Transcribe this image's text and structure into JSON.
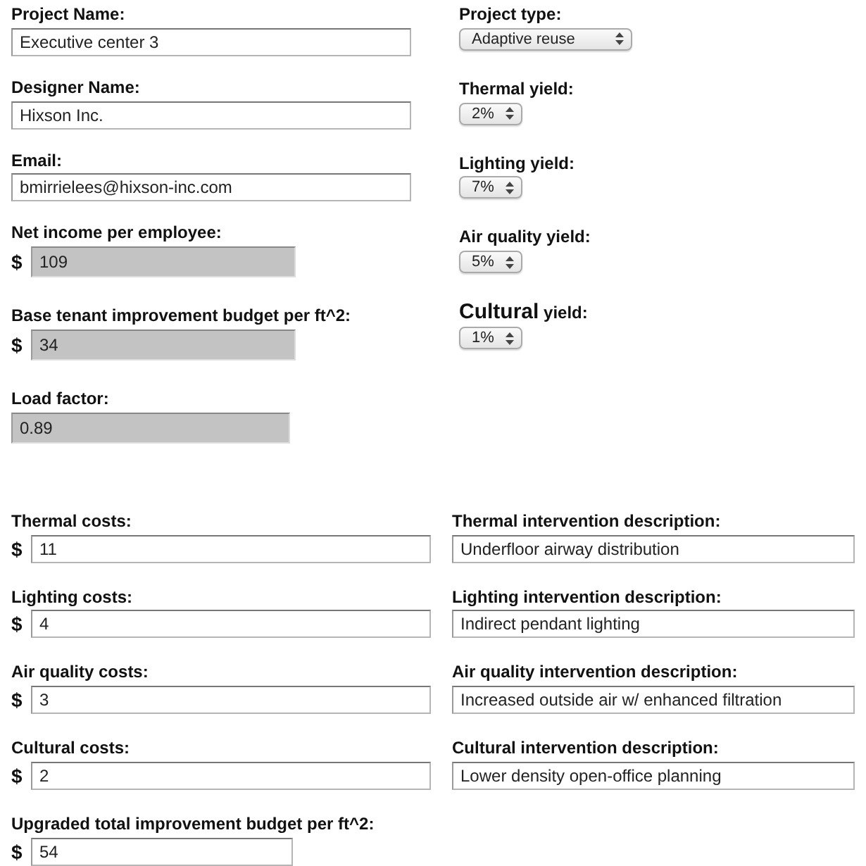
{
  "top_left": [
    {
      "label": "Project Name:",
      "value": "Executive center 3",
      "readonly": false
    },
    {
      "label": "Designer Name:",
      "value": "Hixson Inc.",
      "readonly": false
    },
    {
      "label": "Email:",
      "value": "bmirrielees@hixson-inc.com",
      "readonly": false
    },
    {
      "label": "Net income per employee:",
      "prefix": "$",
      "value": "109",
      "readonly": true
    },
    {
      "label": "Base tenant improvement budget per ft^2:",
      "prefix": "$",
      "value": "34",
      "readonly": true
    },
    {
      "label": "Load factor:",
      "value": "0.89",
      "readonly": true
    }
  ],
  "top_right": [
    {
      "kind": "wide",
      "label": "Project type:",
      "value": "Adaptive reuse"
    },
    {
      "kind": "narrow",
      "label": "Thermal yield:",
      "value": "2%"
    },
    {
      "kind": "narrow",
      "label": "Lighting yield:",
      "value": "7%"
    },
    {
      "kind": "narrow",
      "label": "Air quality yield:",
      "value": "5%"
    },
    {
      "kind": "narrow",
      "label_emphasis": "Cultural",
      "label": "yield:",
      "value": "1%"
    }
  ],
  "interventions": [
    {
      "cost_label": "Thermal costs:",
      "cost_prefix": "$",
      "cost": "11",
      "description_label": "Thermal intervention description:",
      "description": "Underfloor airway distribution"
    },
    {
      "cost_label": "Lighting costs:",
      "cost_prefix": "$",
      "cost": "4",
      "description_label": "Lighting intervention description:",
      "description": "Indirect pendant lighting"
    },
    {
      "cost_label": "Air quality costs:",
      "cost_prefix": "$",
      "cost": "3",
      "description_label": "Air quality intervention description:",
      "description": "Increased outside air w/ enhanced filtration"
    },
    {
      "cost_label": "Cultural costs:",
      "cost_prefix": "$",
      "cost": "2",
      "description_label": "Cultural intervention description:",
      "description": "Lower density open-office planning"
    }
  ],
  "total": {
    "label": "Upgraded total improvement budget per ft^2:",
    "prefix": "$",
    "value": "54"
  }
}
